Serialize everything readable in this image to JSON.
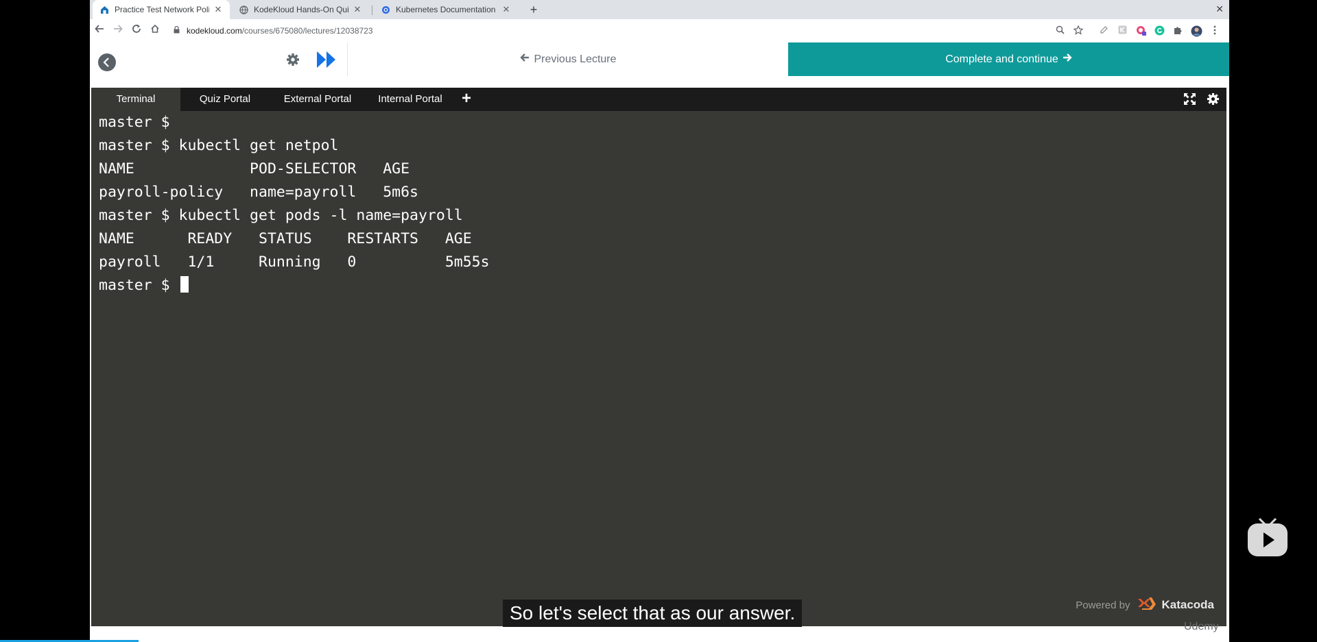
{
  "browser": {
    "tabs": [
      {
        "title": "Practice Test Network Policie",
        "icon": "kodekloud-favicon",
        "active": true
      },
      {
        "title": "KodeKloud Hands-On Quiz",
        "icon": "globe-icon",
        "active": false
      },
      {
        "title": "Kubernetes Documentation |",
        "icon": "kubernetes-icon",
        "active": false
      }
    ],
    "new_tab_symbol": "+",
    "close_symbol": "✕",
    "url_host": "kodekloud.com",
    "url_path": "/courses/675080/lectures/12038723"
  },
  "course_header": {
    "previous_label": "Previous Lecture",
    "complete_label": "Complete and continue"
  },
  "terminal": {
    "tabs": [
      "Terminal",
      "Quiz Portal",
      "External Portal",
      "Internal Portal"
    ],
    "add_tab_symbol": "+",
    "lines": [
      "master $",
      "master $ kubectl get netpol",
      "NAME             POD-SELECTOR   AGE",
      "payroll-policy   name=payroll   5m6s",
      "master $ kubectl get pods -l name=payroll",
      "NAME      READY   STATUS    RESTARTS   AGE",
      "payroll   1/1     Running   0          5m55s",
      "master $ "
    ],
    "powered_by_label": "Powered by",
    "powered_by_brand": "Katacoda"
  },
  "caption": "So let's select that as our answer.",
  "watermark": "Udemy",
  "colors": {
    "accent": "#0f9a9a",
    "terminal_bg": "#383835",
    "progress": "#1aa0e0"
  }
}
